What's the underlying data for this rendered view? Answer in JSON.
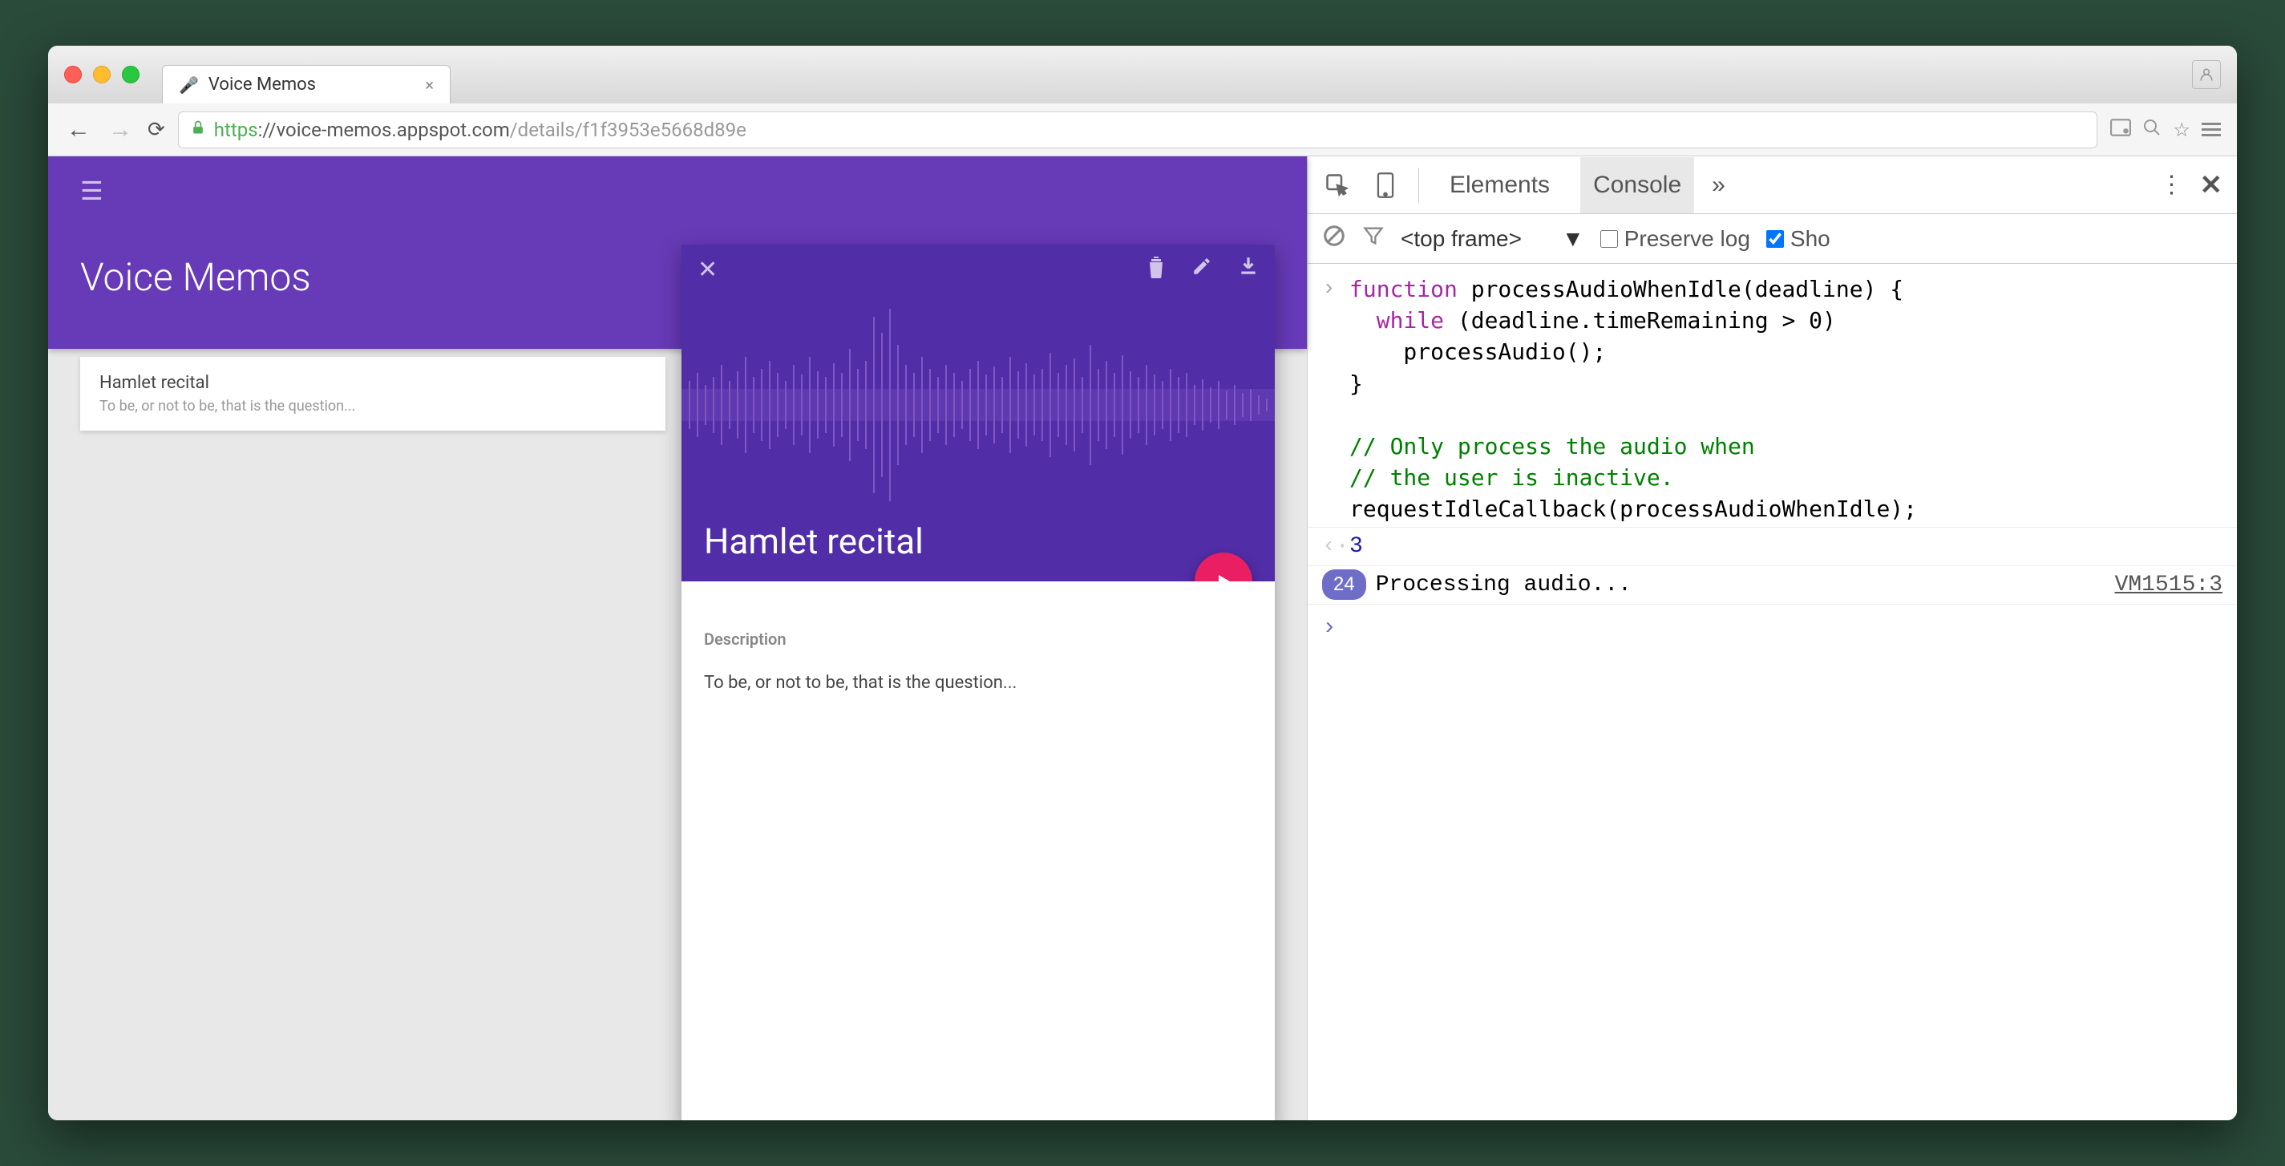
{
  "browser": {
    "tab_title": "Voice Memos",
    "url_https": "https",
    "url_host": "://voice-memos.appspot.com",
    "url_path": "/details/f1f3953e5668d89e"
  },
  "app": {
    "title": "Voice Memos",
    "list_item": {
      "title": "Hamlet recital",
      "subtitle": "To be, or not to be, that is the question..."
    },
    "detail": {
      "title": "Hamlet recital",
      "desc_label": "Description",
      "desc_text": "To be, or not to be, that is the question..."
    }
  },
  "devtools": {
    "tabs": {
      "elements": "Elements",
      "console": "Console"
    },
    "frame_select": "<top frame>",
    "preserve_log": "Preserve log",
    "show": "Sho",
    "code": "function processAudioWhenIdle(deadline) {\n  while (deadline.timeRemaining > 0)\n    processAudio();\n}\n\n// Only process the audio when\n// the user is inactive.\nrequestIdleCallback(processAudioWhenIdle);",
    "return_val": "3",
    "log_count": "24",
    "log_msg": "Processing audio...",
    "log_src": "VM1515:3"
  }
}
